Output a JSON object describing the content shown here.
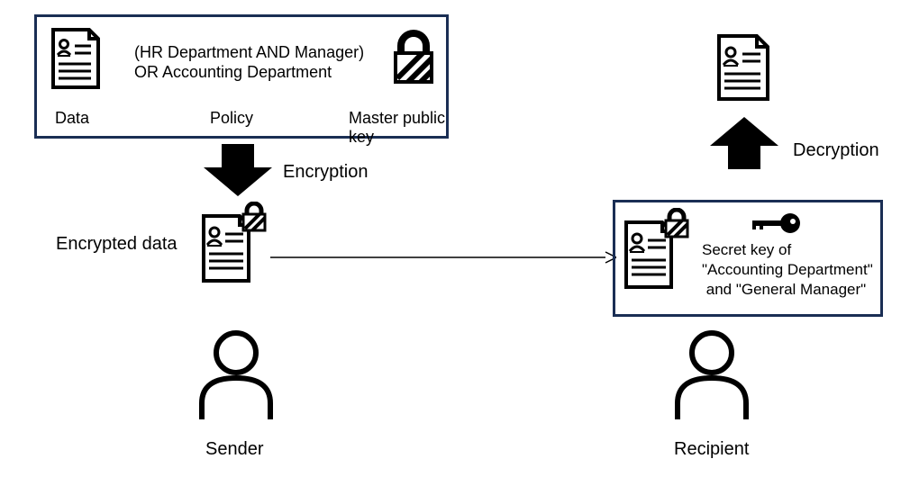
{
  "sender_box": {
    "data_label": "Data",
    "policy_label": "Policy",
    "policy_text": "(HR Department AND Manager)\nOR Accounting Department",
    "mpk_label": "Master public key"
  },
  "encryption_label": "Encryption",
  "encrypted_data_label": "Encrypted data",
  "sender_label": "Sender",
  "recipient_box": {
    "secret_key_text": "Secret key of\n\"Accounting Department\"\n and \"General Manager\""
  },
  "decryption_label": "Decryption",
  "recipient_label": "Recipient"
}
